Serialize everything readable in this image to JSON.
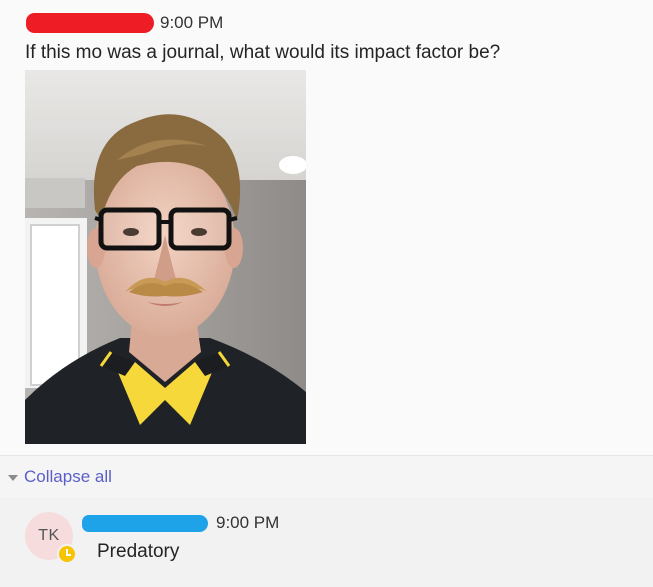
{
  "post": {
    "time": "9:00 PM",
    "text": "If this mo was a journal, what would its impact factor be?",
    "image_alt": "selfie of a man with a mustache and glasses"
  },
  "thread": {
    "collapse_label": "Collapse all"
  },
  "reply": {
    "avatar_initials": "TK",
    "time": "9:00 PM",
    "text": "Predatory",
    "presence_status": "away"
  },
  "colors": {
    "redaction_red": "#ee1c25",
    "redaction_blue": "#1ea2e8",
    "link_purple": "#5b5fc7",
    "presence_away": "#f8c300"
  }
}
